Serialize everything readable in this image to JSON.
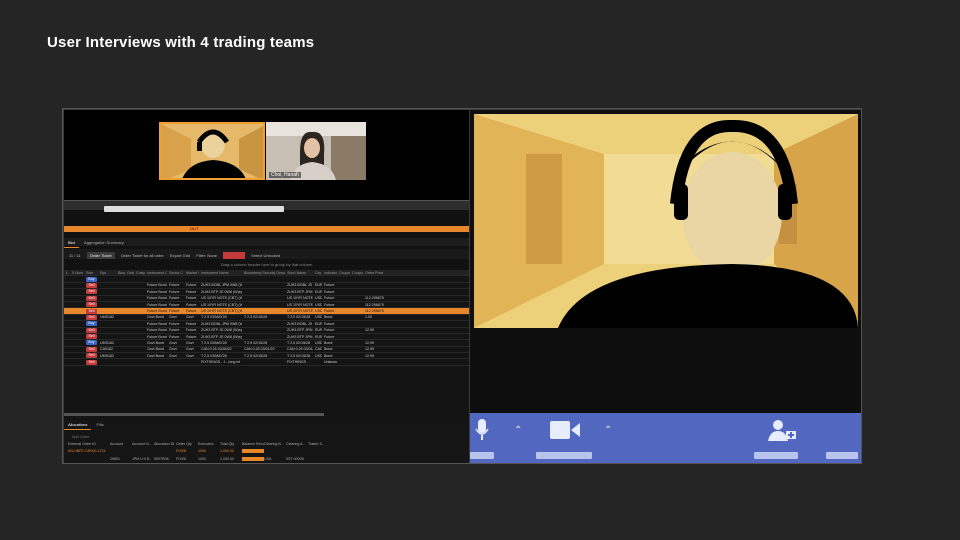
{
  "slide": {
    "title": "User Interviews with 4 trading teams"
  },
  "meeting": {
    "participants": [
      {
        "name": "",
        "active": true
      },
      {
        "name": "Choi, Hanah",
        "active": false
      }
    ]
  },
  "app": {
    "band_label": "OUT",
    "tabs": [
      "Blot",
      "Aggregation Summary"
    ],
    "toolbar": {
      "count": "11 / 11",
      "order_ticket": "Order Ticket",
      "search_placeholder": "Order Ticket for all order",
      "export": "Export Grid",
      "filter_label": "Filter: None",
      "select_unlocked": "Select Unlocked"
    },
    "hint": "Drag a column header here to group by that column",
    "columns": [
      "L",
      "S Num",
      "Side",
      "Sys",
      "Bksg",
      "Order",
      "Cusip",
      "Instrument C",
      "Sector C",
      "Market S",
      "Instrument Name",
      "Bloomberg Security Description",
      "Short Name",
      "Ccy",
      "Indicator",
      "Coupon",
      "Coupon",
      "Order Price"
    ],
    "rows": [
      {
        "side": "Buy",
        "sys": "",
        "type": "",
        "instr": "",
        "name": "",
        "desc": "",
        "short": "",
        "ccy": "",
        "ind": "",
        "price": ""
      },
      {
        "side": "Sell",
        "sys": "",
        "type": "Future",
        "instr": "Bond",
        "name": "ZUH3 BOBL JPM 0W8 (W)eg22 B..",
        "desc": "",
        "short": "ZUH3 BOBL JS",
        "ccy": "EUR",
        "ind": "Future",
        "price": ""
      },
      {
        "side": "Sell",
        "sys": "",
        "type": "Future",
        "instr": "Bond",
        "name": "ZUH3 BTP JE 0W8 (W)eg22 RB SH",
        "desc": "",
        "short": "ZUH3 BTP JPM",
        "ccy": "EUR",
        "ind": "Future",
        "price": ""
      },
      {
        "side": "Sell",
        "sys": "",
        "type": "Future",
        "instr": "Bond",
        "name": "US 10YR NOTE (CBT) (W)eg22 TR3M",
        "desc": "",
        "short": "US 10YR NOTE",
        "ccy": "USD",
        "ind": "Future",
        "price": "112.296875"
      },
      {
        "side": "Sell",
        "sys": "",
        "type": "Future",
        "instr": "Bond",
        "name": "US 10YR NOTE (CBT) (W)eg22 TR3M",
        "desc": "",
        "short": "US 10YR NOTE",
        "ccy": "USD",
        "ind": "Future",
        "price": "112.296875"
      },
      {
        "side": "Sell",
        "sys": "",
        "type": "Future",
        "instr": "Bond",
        "name": "US 10YR NOTE (CBT) (W)eg22 TR3M",
        "desc": "",
        "short": "US 10YR NOTE",
        "ccy": "USD",
        "ind": "Future",
        "price": "112.296875",
        "selected": true
      },
      {
        "side": "Sell",
        "sys": "UMS182",
        "type": "Govt",
        "instr": "Bond",
        "name": "T 2.5 03/MAY28",
        "desc": "T 2.5 02/15/28",
        "short": "T 2.5 02/15/28",
        "ccy": "USD",
        "ind": "Bond",
        "price": "1.00"
      },
      {
        "side": "Buy",
        "sys": "",
        "type": "Future",
        "instr": "Bond",
        "name": "ZUH3 BOBL JPM 0W8 (W)eg22 B..",
        "desc": "",
        "short": "ZUH3 BOBL JS",
        "ccy": "EUR",
        "ind": "Future",
        "price": ""
      },
      {
        "side": "Sell",
        "sys": "",
        "type": "Future",
        "instr": "Bond",
        "name": "ZUH3 BTP JE 0W8 (W)eg22 RB SH",
        "desc": "",
        "short": "ZUH3 BTP JPM",
        "ccy": "EUR",
        "ind": "Future",
        "price": "12.99"
      },
      {
        "side": "Sell",
        "sys": "",
        "type": "Future",
        "instr": "Bond",
        "name": "ZUH3 BTP JE 0W8 (W)eg22 RB SH",
        "desc": "",
        "short": "ZUH3 BTP JPM",
        "ccy": "EUR",
        "ind": "Future",
        "price": ""
      },
      {
        "side": "Buy",
        "sys": "UMS182",
        "type": "Govt",
        "instr": "Bond",
        "name": "T 2.5 03/MAY28",
        "desc": "T 2.5 02/15/28",
        "short": "T 2.5 02/15/28",
        "ccy": "USD",
        "ind": "Bond",
        "price": "12.99"
      },
      {
        "side": "Sell",
        "sys": "CA5182",
        "type": "Govt",
        "instr": "Bond",
        "name": "CAN 0.25 03/AN22",
        "desc": "CAN 0.25 03/01/22",
        "short": "CAN 0.25 03/01/22",
        "ccy": "CAD",
        "ind": "Bond",
        "price": "12.99"
      },
      {
        "side": "Sell",
        "sys": "UMS182",
        "type": "Govt",
        "instr": "Bond",
        "name": "T 2.5 03/MAY28",
        "desc": "T 2.5 02/15/28",
        "short": "T 2.5 02/15/28",
        "ccy": "USD",
        "ind": "Bond",
        "price": "12.99"
      },
      {
        "side": "Sell",
        "sys": "",
        "type": "",
        "instr": "",
        "name": "FIXTHINGS - 1 - long int",
        "desc": "",
        "short": "FIXTHINGS",
        "ccy": "",
        "ind": "Unknown",
        "price": ""
      }
    ],
    "alloc": {
      "tabs": [
        "Allocations",
        "Fills"
      ],
      "split": "Split Order",
      "columns": [
        "External Order ID",
        "Account",
        "Account N..",
        "Allocation ID",
        "Order Qty",
        "Executed..",
        "Total Qty",
        "Balance Remai..",
        "Clearing B..",
        "Clearing A..",
        "Trader S.."
      ],
      "row1": [
        "AN-HBFE-OR000-1724",
        "",
        "",
        "",
        "FIXE8",
        "1000",
        "1,000.00",
        "",
        "",
        "",
        ""
      ],
      "row2": [
        "",
        "29851",
        "JPM LHI R..",
        "5007R08",
        "FIXE8",
        "1000",
        "1,000.00",
        "",
        "USA",
        "5ST 0000B",
        ""
      ]
    }
  }
}
